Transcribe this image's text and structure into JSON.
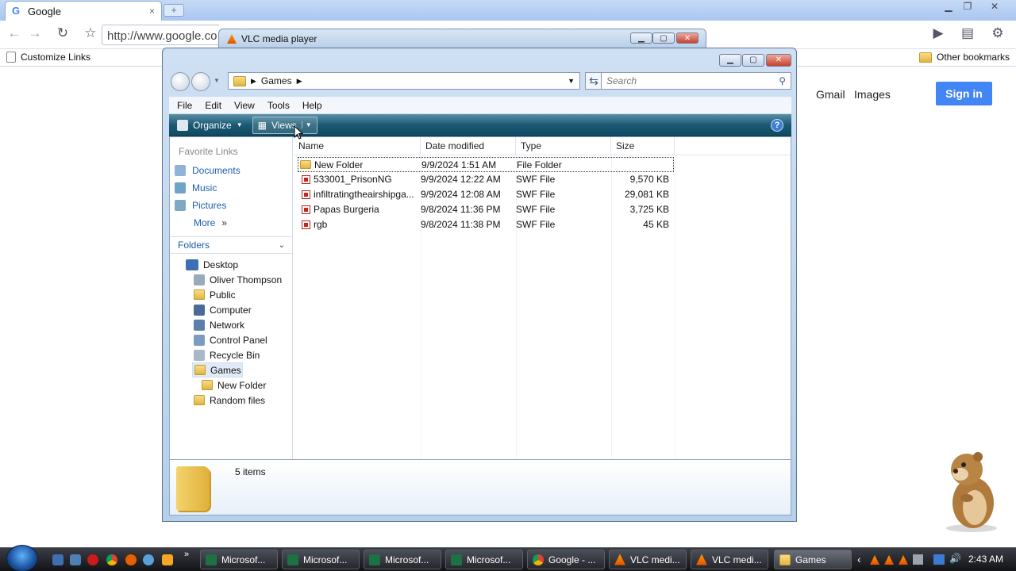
{
  "chrome": {
    "tab_title": "Google",
    "tab_close": "×",
    "new_tab": "+",
    "url": "http://www.google.co",
    "bookmark_customize": "Customize Links",
    "bookmark_other": "Other bookmarks"
  },
  "vlc": {
    "title": "VLC media player"
  },
  "explorer": {
    "path_folder": "Games",
    "search_placeholder": "Search",
    "menu": [
      "File",
      "Edit",
      "View",
      "Tools",
      "Help"
    ],
    "organize_label": "Organize",
    "views_label": "Views",
    "help_icon": "?",
    "favorite_links_title": "Favorite Links",
    "favorite_links": [
      "Documents",
      "Music",
      "Pictures"
    ],
    "more_label": "More",
    "more_glyph": "»",
    "folders_title": "Folders",
    "tree": [
      {
        "label": "Desktop",
        "indent": 0
      },
      {
        "label": "Oliver Thompson",
        "indent": 1
      },
      {
        "label": "Public",
        "indent": 1
      },
      {
        "label": "Computer",
        "indent": 1
      },
      {
        "label": "Network",
        "indent": 1
      },
      {
        "label": "Control Panel",
        "indent": 1
      },
      {
        "label": "Recycle Bin",
        "indent": 1
      },
      {
        "label": "Games",
        "indent": 1,
        "selected": true
      },
      {
        "label": "New Folder",
        "indent": 2
      },
      {
        "label": "Random files",
        "indent": 1
      }
    ],
    "columns": [
      "Name",
      "Date modified",
      "Type",
      "Size"
    ],
    "files": [
      {
        "name": "New Folder",
        "date": "9/9/2024 1:51 AM",
        "type": "File Folder",
        "size": "",
        "kind": "folder"
      },
      {
        "name": "533001_PrisonNG",
        "date": "9/9/2024 12:22 AM",
        "type": "SWF File",
        "size": "9,570 KB",
        "kind": "swf"
      },
      {
        "name": "infiltratingtheairshipga...",
        "date": "9/9/2024 12:08 AM",
        "type": "SWF File",
        "size": "29,081 KB",
        "kind": "swf"
      },
      {
        "name": "Papas Burgeria",
        "date": "9/8/2024 11:36 PM",
        "type": "SWF File",
        "size": "3,725 KB",
        "kind": "swf"
      },
      {
        "name": "rgb",
        "date": "9/8/2024 11:38 PM",
        "type": "SWF File",
        "size": "45 KB",
        "kind": "swf"
      }
    ],
    "item_count": "5 items"
  },
  "google": {
    "gmail": "Gmail",
    "images": "Images",
    "sign_in": "Sign in"
  },
  "taskbar": {
    "more_glyph": "»",
    "buttons": [
      {
        "label": "Microsof...",
        "icon": "excel-icon",
        "active": false
      },
      {
        "label": "Microsof...",
        "icon": "excel-icon",
        "active": false
      },
      {
        "label": "Microsof...",
        "icon": "excel-icon",
        "active": false
      },
      {
        "label": "Microsof...",
        "icon": "excel-icon",
        "active": false
      },
      {
        "label": "Google - ...",
        "icon": "chrome-icon",
        "active": false
      },
      {
        "label": "VLC medi...",
        "icon": "vlc-icon",
        "active": false
      },
      {
        "label": "VLC medi...",
        "icon": "vlc-icon",
        "active": false
      },
      {
        "label": "Games",
        "icon": "folder-icon",
        "active": true
      }
    ],
    "tray_arrow": "‹",
    "clock": "2:43 AM"
  },
  "colors": {
    "excel": "#1e7145",
    "chrome_blue": "#4285f4",
    "vlc_orange": "#f57c00",
    "folder": "#e8c152"
  }
}
